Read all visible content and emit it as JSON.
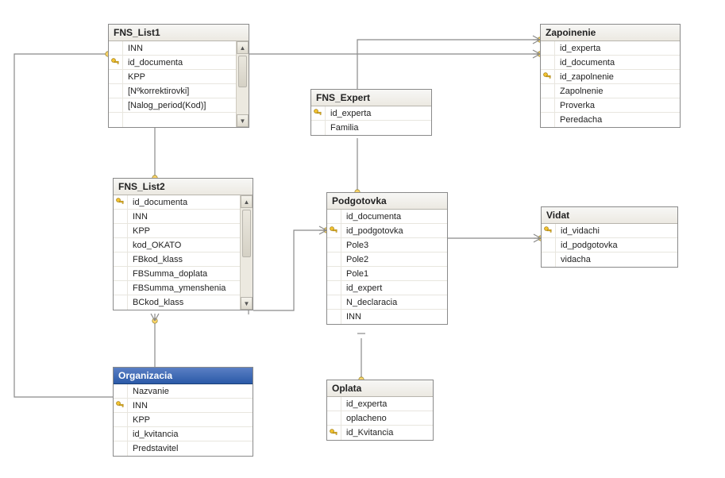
{
  "tables": {
    "fns_list1": {
      "title": "FNS_List1",
      "fields": [
        {
          "name": "INN",
          "pk": false
        },
        {
          "name": "id_documenta",
          "pk": true
        },
        {
          "name": "KPP",
          "pk": false
        },
        {
          "name": "[Nºkorrektirovki]",
          "pk": false
        },
        {
          "name": "[Nalog_period(Kod)]",
          "pk": false
        }
      ],
      "scroll_up": "▲",
      "scroll_down": "▼"
    },
    "fns_list2": {
      "title": "FNS_List2",
      "fields": [
        {
          "name": "id_documenta",
          "pk": true
        },
        {
          "name": "INN",
          "pk": false
        },
        {
          "name": "KPP",
          "pk": false
        },
        {
          "name": "kod_OKATO",
          "pk": false
        },
        {
          "name": "FBkod_klass",
          "pk": false
        },
        {
          "name": "FBSumma_doplata",
          "pk": false
        },
        {
          "name": "FBSumma_ymenshenia",
          "pk": false
        },
        {
          "name": "BCkod_klass",
          "pk": false
        }
      ],
      "scroll_up": "▲",
      "scroll_down": "▼"
    },
    "organizacia": {
      "title": "Organizacia",
      "fields": [
        {
          "name": "Nazvanie",
          "pk": false
        },
        {
          "name": "INN",
          "pk": true
        },
        {
          "name": "KPP",
          "pk": false
        },
        {
          "name": "id_kvitancia",
          "pk": false
        },
        {
          "name": "Predstavitel",
          "pk": false
        }
      ]
    },
    "fns_expert": {
      "title": "FNS_Expert",
      "fields": [
        {
          "name": "id_experta",
          "pk": true
        },
        {
          "name": "Familia",
          "pk": false
        }
      ]
    },
    "podgotovka": {
      "title": "Podgotovka",
      "fields": [
        {
          "name": "id_documenta",
          "pk": false
        },
        {
          "name": "id_podgotovka",
          "pk": true
        },
        {
          "name": "Pole3",
          "pk": false
        },
        {
          "name": "Pole2",
          "pk": false
        },
        {
          "name": "Pole1",
          "pk": false
        },
        {
          "name": "id_expert",
          "pk": false
        },
        {
          "name": "N_declaracia",
          "pk": false
        },
        {
          "name": "INN",
          "pk": false
        }
      ]
    },
    "zapolnenie": {
      "title": "Zapoinenie",
      "fields": [
        {
          "name": "id_experta",
          "pk": false
        },
        {
          "name": "id_documenta",
          "pk": false
        },
        {
          "name": "id_zapolnenie",
          "pk": true
        },
        {
          "name": "Zapolnenie",
          "pk": false
        },
        {
          "name": "Proverka",
          "pk": false
        },
        {
          "name": "Peredacha",
          "pk": false
        }
      ]
    },
    "vidat": {
      "title": "Vidat",
      "fields": [
        {
          "name": "id_vidachi",
          "pk": true
        },
        {
          "name": "id_podgotovka",
          "pk": false
        },
        {
          "name": "vidacha",
          "pk": false
        }
      ]
    },
    "oplata": {
      "title": "Oplata",
      "fields": [
        {
          "name": "id_experta",
          "pk": false
        },
        {
          "name": "oplacheno",
          "pk": false
        },
        {
          "name": "id_Kvitancia",
          "pk": true
        }
      ]
    }
  },
  "colors": {
    "connector": "#8a8a8a",
    "endpoint_fill": "#ffd700",
    "selected_header": "#2b5aa8"
  }
}
